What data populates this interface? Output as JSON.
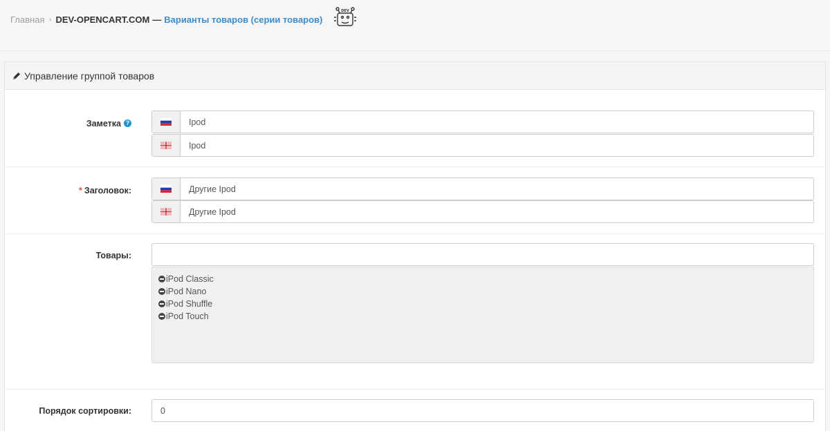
{
  "breadcrumb": {
    "home": "Главная",
    "separator": "›",
    "site": "DEV-OPENCART.COM",
    "dash": "—",
    "page": "Варианты товаров (серии товаров)"
  },
  "panel": {
    "title": "Управление группой товаров",
    "icon": "pencil-icon"
  },
  "fields": {
    "note": {
      "label": "Заметка",
      "help_icon": "question-circle-icon",
      "values": [
        {
          "language": "ru",
          "flag_icon": "flag-russia-icon",
          "value": "Ipod"
        },
        {
          "language": "en",
          "flag_icon": "flag-uk-icon",
          "value": "Ipod"
        }
      ]
    },
    "heading": {
      "required_mark": "*",
      "label": "Заголовок:",
      "values": [
        {
          "language": "ru",
          "flag_icon": "flag-russia-icon",
          "value": "Другие Ipod"
        },
        {
          "language": "en",
          "flag_icon": "flag-uk-icon",
          "value": "Другие Ipod"
        }
      ]
    },
    "products": {
      "label": "Товары:",
      "input_value": "",
      "items": [
        "iPod Classic",
        "iPod Nano",
        "iPod Shuffle",
        "iPod Touch"
      ]
    },
    "sort_order": {
      "label": "Порядок сортировки:",
      "value": "0"
    }
  },
  "colors": {
    "link": "#3c8dcb",
    "required": "#e3503e",
    "help": "#1e91cf"
  }
}
